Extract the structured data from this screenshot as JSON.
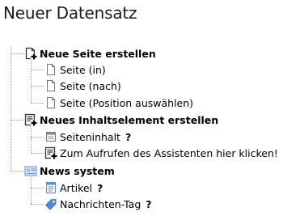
{
  "page": {
    "title": "Neuer Datensatz"
  },
  "groups": [
    {
      "label": "Neue Seite erstellen",
      "icon": "page-new-icon",
      "items": [
        {
          "label": "Seite (in)",
          "icon": "page-icon"
        },
        {
          "label": "Seite (nach)",
          "icon": "page-icon"
        },
        {
          "label": "Seite (Position auswählen)",
          "icon": "page-icon"
        }
      ]
    },
    {
      "label": "Neues Inhaltselement erstellen",
      "icon": "content-new-icon",
      "items": [
        {
          "label": "Seiteninhalt",
          "icon": "content-icon",
          "help": "?"
        },
        {
          "label": "Zum Aufrufen des Assistenten hier klicken!",
          "icon": "content-wizard-icon"
        }
      ]
    },
    {
      "label": "News system",
      "icon": "news-folder-icon",
      "items": [
        {
          "label": "Artikel",
          "icon": "article-icon",
          "help": "?"
        },
        {
          "label": "Nachrichten-Tag",
          "icon": "tag-icon",
          "help": "?"
        }
      ]
    }
  ],
  "colors": {
    "tag": "#4a8fd9",
    "news": "#5b8fd6",
    "connector": "#9a9a9a"
  }
}
